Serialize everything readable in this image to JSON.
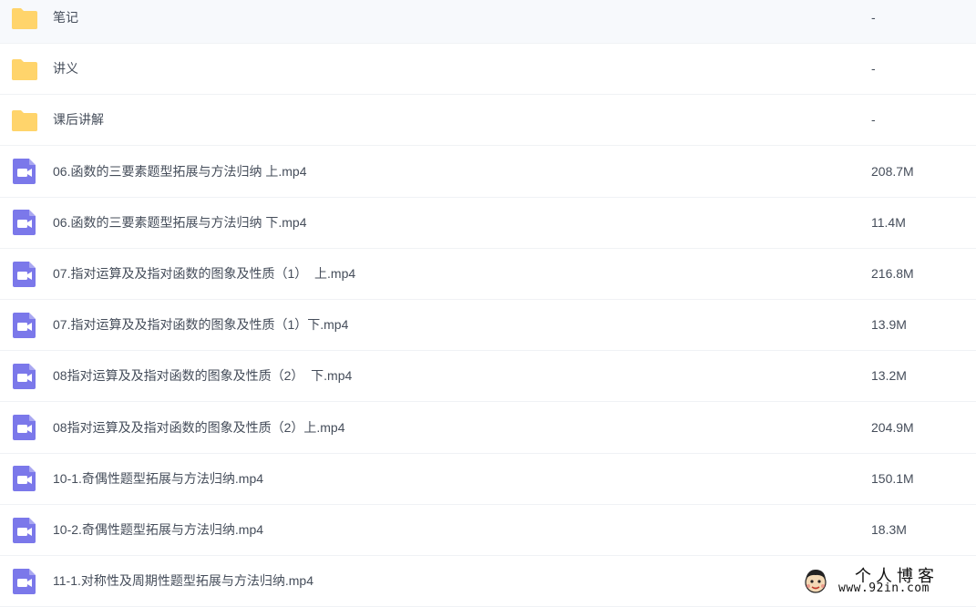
{
  "files": [
    {
      "type": "folder",
      "name": "笔记",
      "size": "-"
    },
    {
      "type": "folder",
      "name": "讲义",
      "size": "-"
    },
    {
      "type": "folder",
      "name": "课后讲解",
      "size": "-"
    },
    {
      "type": "video",
      "name": "06.函数的三要素题型拓展与方法归纳 上.mp4",
      "size": "208.7M"
    },
    {
      "type": "video",
      "name": "06.函数的三要素题型拓展与方法归纳 下.mp4",
      "size": "11.4M"
    },
    {
      "type": "video",
      "name": "07.指对运算及及指对函数的图象及性质（1）  上.mp4",
      "size": "216.8M"
    },
    {
      "type": "video",
      "name": "07.指对运算及及指对函数的图象及性质（1）下.mp4",
      "size": "13.9M"
    },
    {
      "type": "video",
      "name": "08指对运算及及指对函数的图象及性质（2）  下.mp4",
      "size": "13.2M"
    },
    {
      "type": "video",
      "name": "08指对运算及及指对函数的图象及性质（2）上.mp4",
      "size": "204.9M"
    },
    {
      "type": "video",
      "name": "10-1.奇偶性题型拓展与方法归纳.mp4",
      "size": "150.1M"
    },
    {
      "type": "video",
      "name": "10-2.奇偶性题型拓展与方法归纳.mp4",
      "size": "18.3M"
    },
    {
      "type": "video",
      "name": "11-1.对称性及周期性题型拓展与方法归纳.mp4",
      "size": ""
    }
  ],
  "icons": {
    "folder": "folder-icon",
    "video": "video-file-icon"
  },
  "colors": {
    "folder": "#ffd46b",
    "video": "#7b78ea",
    "text": "#454d5a",
    "divider": "#f0f2f5"
  },
  "watermark": {
    "title": "个人博客",
    "url": "www.92in.com"
  }
}
